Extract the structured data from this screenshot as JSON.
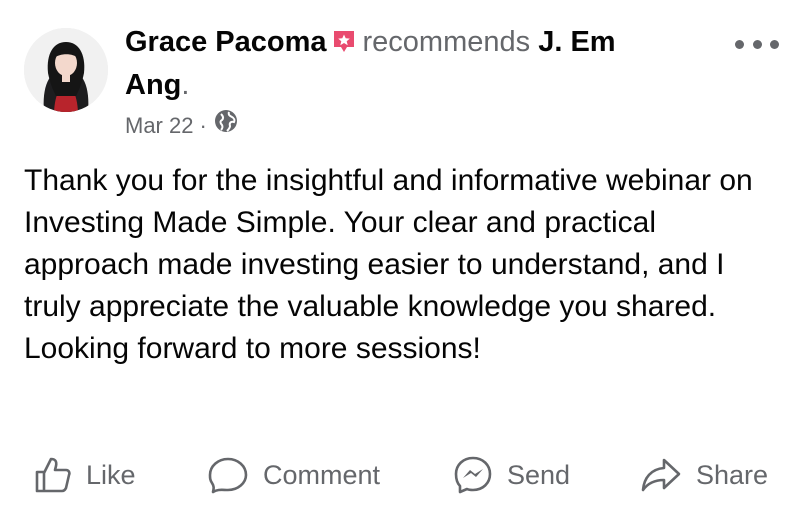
{
  "post": {
    "author": "Grace Pacoma",
    "verb": "recommends",
    "target_line1": "J. Em",
    "target_line2": "Ang",
    "target_end": ".",
    "date": "Mar 22",
    "separator": "·",
    "privacy_icon": "globe-icon",
    "recommend_icon": "recommend-star-icon",
    "more_icon": "more-options-icon",
    "body": "Thank you for the insightful and informative webinar on Investing Made Simple. Your clear and practical approach made investing easier to understand, and I truly appreciate the valuable knowledge you shared. Looking forward to more sessions!"
  },
  "actions": {
    "like": {
      "label": "Like",
      "icon": "thumbs-up-icon"
    },
    "comment": {
      "label": "Comment",
      "icon": "comment-bubble-icon"
    },
    "send": {
      "label": "Send",
      "icon": "messenger-icon"
    },
    "share": {
      "label": "Share",
      "icon": "share-arrow-icon"
    }
  },
  "colors": {
    "text": "#050505",
    "secondary": "#65676b",
    "badge": "#e94b6f"
  }
}
